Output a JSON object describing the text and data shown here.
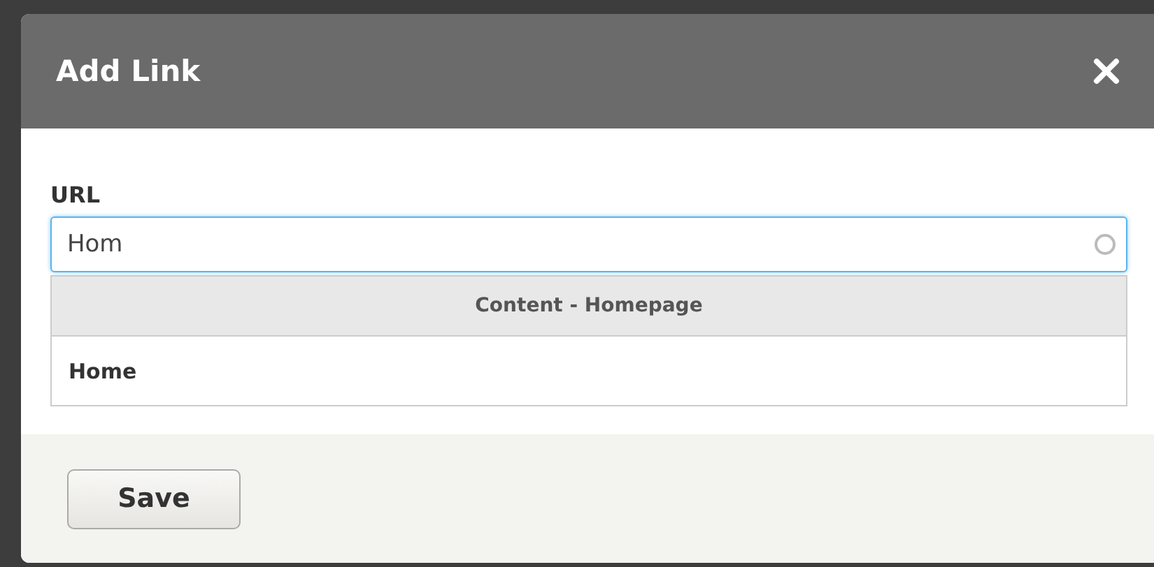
{
  "dialog": {
    "title": "Add Link"
  },
  "url_field": {
    "label": "URL",
    "value": "Hom"
  },
  "autocomplete": {
    "group": "Content - Homepage",
    "items": [
      {
        "label": "Home"
      }
    ]
  },
  "buttons": [
    {
      "label": "Save"
    }
  ]
}
